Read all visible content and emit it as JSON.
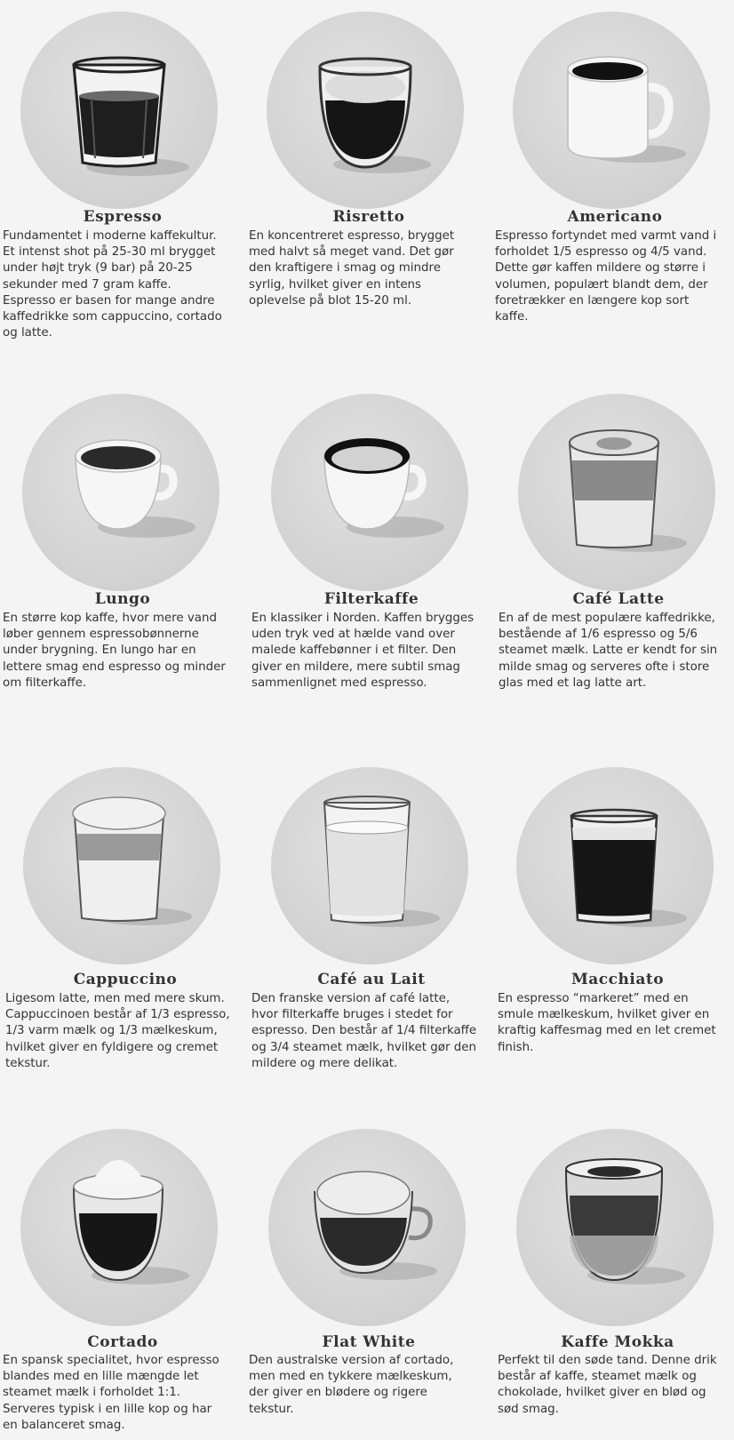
{
  "drinks": [
    {
      "name": "Espresso",
      "description": "Fundamentet i moderne kaffekultur.\nEt intenst shot på 25-30 ml brygget\nunder højt tryk (9 bar) på 20-25\nsekunder med 7 gram kaffe.\nEspresso er basen for mange andre\nkaffedrikke som cappuccino, cortado\nog latte.",
      "icon": "espresso-glass-icon"
    },
    {
      "name": "Risretto",
      "description": "En koncentreret espresso, brygget\nmed halvt så meget vand. Det gør\nden kraftigere i smag og mindre\nsyrlig, hvilket giver en intens\noplevelse på blot 15-20 ml.",
      "icon": "ristretto-glass-icon"
    },
    {
      "name": "Americano",
      "description": "Espresso fortyndet med varmt vand i\nforholdet 1/5 espresso og 4/5 vand.\nDette gør kaffen mildere og større i\nvolumen, populært blandt dem, der\nforetrækker en længere kop sort\nkaffe.",
      "icon": "americano-mug-icon"
    },
    {
      "name": "Lungo",
      "description": "En større kop kaffe, hvor mere vand\nløber gennem espressobønnerne\nunder brygning. En lungo har en\nlettere smag end espresso og minder\nom filterkaffe.",
      "icon": "lungo-cup-icon"
    },
    {
      "name": "Filterkaffe",
      "description": "En klassiker i Norden. Kaffen brygges\nuden tryk ved at hælde vand over\nmalede kaffebønner i et filter. Den\ngiver en mildere, mere subtil smag\nsammenlignet med espresso.",
      "icon": "filter-coffee-cup-icon"
    },
    {
      "name": "Café Latte",
      "description": "En af de mest populære kaffedrikke,\nbestående af 1/6 espresso og 5/6\nsteamet mælk. Latte er kendt for sin\nmilde smag og serveres ofte i store\nglas med et lag latte art.",
      "icon": "latte-glass-icon"
    },
    {
      "name": "Cappuccino",
      "description": "Ligesom latte, men med mere skum.\nCappuccinoen består af 1/3 espresso,\n1/3 varm mælk og 1/3 mælkeskum,\nhvilket giver en fyldigere og cremet\ntekstur.",
      "icon": "cappuccino-glass-icon"
    },
    {
      "name": "Café au Lait",
      "description": "Den franske version af café latte,\nhvor filterkaffe bruges i stedet for\nespresso. Den består af 1/4 filterkaffe\nog 3/4 steamet mælk, hvilket gør den\nmildere og mere delikat.",
      "icon": "cafe-au-lait-glass-icon"
    },
    {
      "name": "Macchiato",
      "description": "En espresso “markeret” med en\nsmule mælkeskum, hvilket giver en\nkraftig kaffesmag med en let cremet\nfinish.",
      "icon": "macchiato-glass-icon"
    },
    {
      "name": "Cortado",
      "description": "En spansk specialitet, hvor espresso\nblandes med en lille mængde let\nsteamet mælk i forholdet 1:1.\nServeres typisk i en lille kop og har\nen balanceret smag.",
      "icon": "cortado-glass-icon"
    },
    {
      "name": "Flat White",
      "description": "Den australske version af cortado,\nmen med en tykkere mælkeskum,\nder giver en blødere og rigere\ntekstur.",
      "icon": "flat-white-cup-icon"
    },
    {
      "name": "Kaffe Mokka",
      "description": "Perfekt til den søde tand. Denne drik\nbestår af kaffe, steamet mælk og\nchokolade, hvilket giver en blød og\nsød smag.",
      "icon": "mokka-glass-icon"
    }
  ]
}
